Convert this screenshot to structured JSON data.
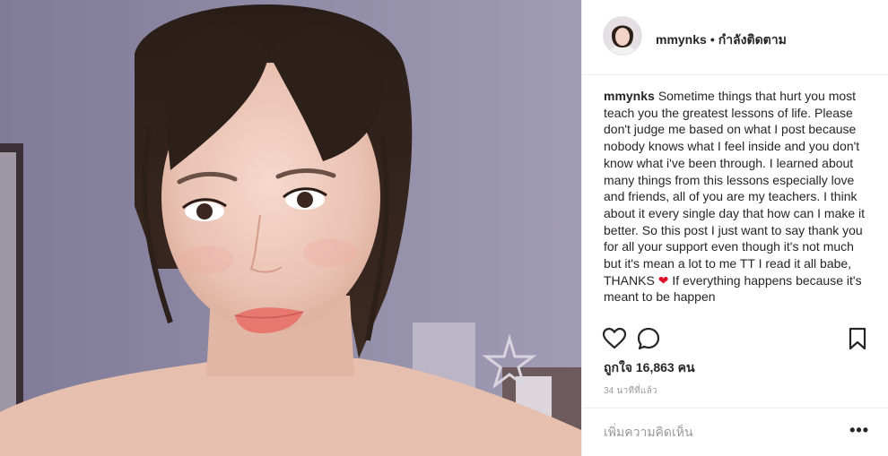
{
  "header": {
    "username": "mmynks",
    "separator": "•",
    "follow_status": "กำลังติดตาม"
  },
  "caption": {
    "username": "mmynks",
    "text_before_emoji": "Sometime things that hurt you most teach you the greatest lessons of life. Please don't judge me based on what I post because nobody knows what I feel inside and you don't know what i've been through. I learned about many things from this lessons especially love and friends, all of you are my teachers. I think about it every single day that how can I make it better. So this post I just want to say thank you for all your support even though it's not much but it's mean a lot to me TT I read it all babe, THANKS",
    "emoji": "❤",
    "text_after_emoji": "If everything happens because it's meant to be happen"
  },
  "actions": {
    "like_icon": "heart-outline-icon",
    "comment_icon": "comment-bubble-icon",
    "save_icon": "bookmark-icon"
  },
  "likes": {
    "label": "ถูกใจ 16,863 คน"
  },
  "timestamp": "34 นาทีที่แล้ว",
  "comment": {
    "placeholder": "เพิ่มความคิดเห็น",
    "more_label": "•••"
  },
  "colors": {
    "border": "#efefef",
    "text": "#262626",
    "muted": "#999999",
    "heart": "#e0112b"
  }
}
